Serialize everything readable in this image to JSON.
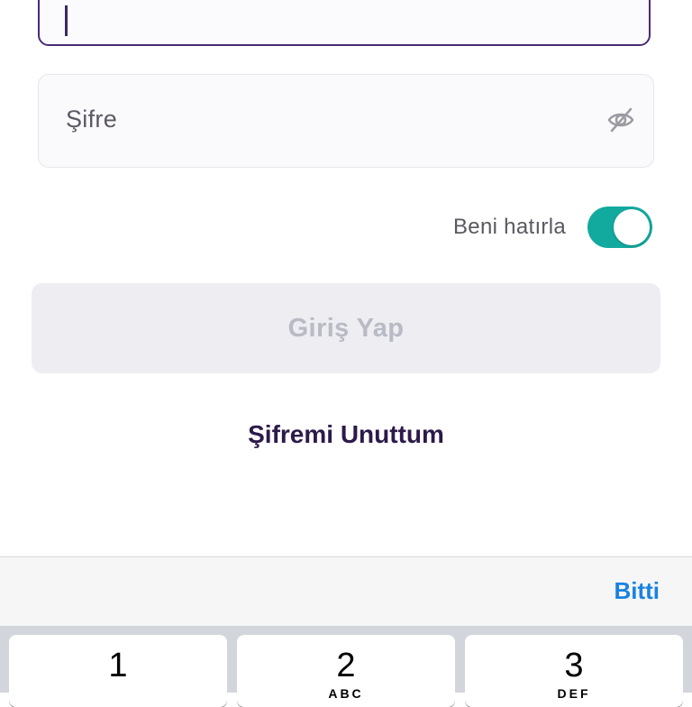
{
  "form": {
    "password_placeholder": "Şifre",
    "remember_label": "Beni hatırla",
    "remember_enabled": true,
    "login_label": "Giriş Yap",
    "forgot_label": "Şifremi Unuttum"
  },
  "toolbar": {
    "done_label": "Bitti"
  },
  "keyboard": {
    "keys": [
      {
        "number": "1",
        "letters": ""
      },
      {
        "number": "2",
        "letters": "ABC"
      },
      {
        "number": "3",
        "letters": "DEF"
      }
    ]
  },
  "colors": {
    "accent": "#12aa9f",
    "focus_border": "#4a2a7a",
    "link": "#1a82e0"
  }
}
